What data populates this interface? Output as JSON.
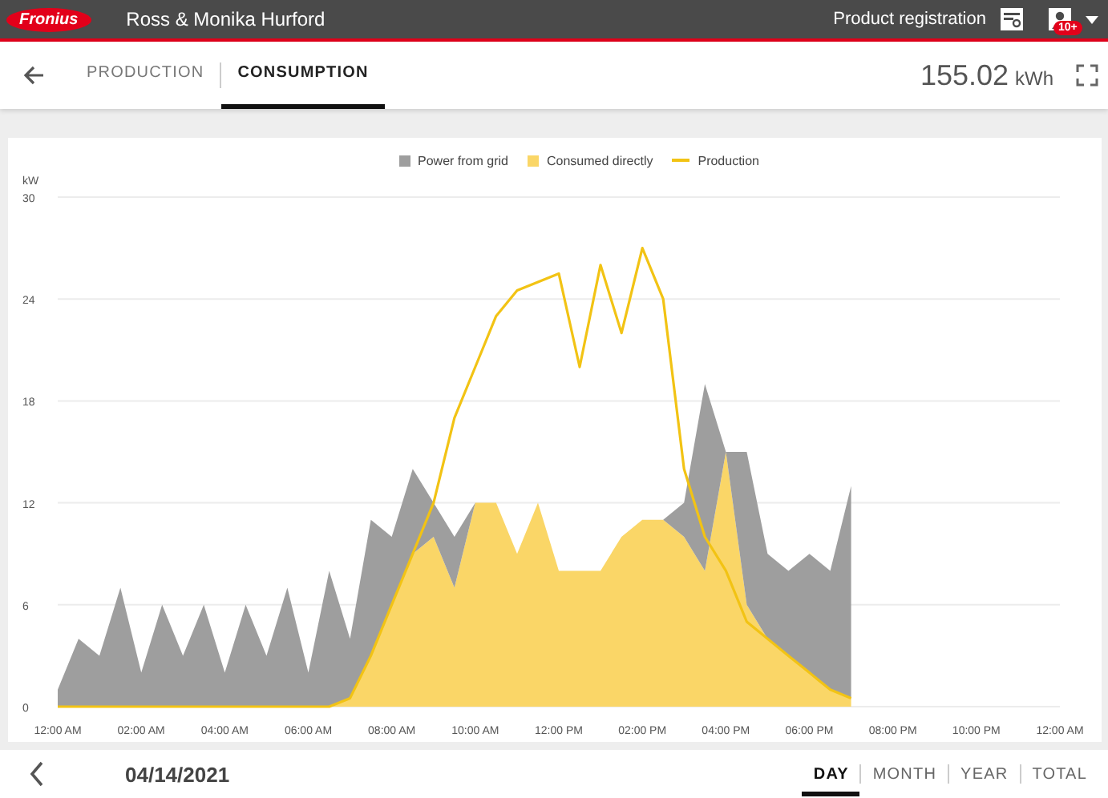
{
  "header": {
    "logo": "Fronius",
    "user_name": "Ross & Monika Hurford",
    "product_registration": "Product registration",
    "notification_badge": "10+"
  },
  "tabs": [
    {
      "label": "PRODUCTION",
      "selected": false
    },
    {
      "label": "CONSUMPTION",
      "selected": true
    }
  ],
  "total": {
    "value": "155.02",
    "unit": "kWh"
  },
  "chart": {
    "unit_label": "kW",
    "chart_data": {
      "type": "area",
      "stacked": true,
      "grid": true,
      "x": [
        0,
        0.5,
        1,
        1.5,
        2,
        2.5,
        3,
        3.5,
        4,
        4.5,
        5,
        5.5,
        6,
        6.5,
        7,
        7.5,
        8,
        8.5,
        9,
        9.5,
        10,
        10.5,
        11,
        11.5,
        12,
        12.5,
        13,
        13.5,
        14,
        14.5,
        15,
        15.5,
        16,
        16.5,
        17,
        17.5,
        18,
        18.5,
        19
      ],
      "xlim": [
        0,
        24
      ],
      "ylim": [
        0,
        30
      ],
      "yticks": [
        0,
        6,
        12,
        18,
        24,
        30
      ],
      "xticks": [
        {
          "value": 0,
          "label": "12:00 AM"
        },
        {
          "value": 2,
          "label": "02:00 AM"
        },
        {
          "value": 4,
          "label": "04:00 AM"
        },
        {
          "value": 6,
          "label": "06:00 AM"
        },
        {
          "value": 8,
          "label": "08:00 AM"
        },
        {
          "value": 10,
          "label": "10:00 AM"
        },
        {
          "value": 12,
          "label": "12:00 PM"
        },
        {
          "value": 14,
          "label": "02:00 PM"
        },
        {
          "value": 16,
          "label": "04:00 PM"
        },
        {
          "value": 18,
          "label": "06:00 PM"
        },
        {
          "value": 20,
          "label": "08:00 PM"
        },
        {
          "value": 22,
          "label": "10:00 PM"
        },
        {
          "value": 24,
          "label": "12:00 AM"
        }
      ],
      "series": [
        {
          "name": "Power from grid",
          "color": "#9e9e9e",
          "type": "area",
          "values": [
            1,
            4,
            3,
            7,
            2,
            6,
            3,
            6,
            2,
            6,
            3,
            7,
            2,
            8,
            3.5,
            8,
            4,
            5,
            2,
            3,
            0,
            0,
            0,
            0,
            0,
            0,
            0,
            0,
            0,
            0,
            2,
            11,
            0,
            9,
            5,
            5,
            7,
            7,
            12.5
          ]
        },
        {
          "name": "Consumed directly",
          "color": "#fad667",
          "type": "area",
          "values": [
            0,
            0,
            0,
            0,
            0,
            0,
            0,
            0,
            0,
            0,
            0,
            0,
            0,
            0,
            0.5,
            3,
            6,
            9,
            10,
            7,
            12,
            12,
            9,
            12,
            8,
            8,
            8,
            10,
            11,
            11,
            10,
            8,
            15,
            6,
            4,
            3,
            2,
            1,
            0.5
          ]
        },
        {
          "name": "Production",
          "color": "#f2c314",
          "type": "line",
          "values": [
            0,
            0,
            0,
            0,
            0,
            0,
            0,
            0,
            0,
            0,
            0,
            0,
            0,
            0,
            0.5,
            3,
            6,
            9,
            12,
            17,
            20,
            23,
            24.5,
            25,
            25.5,
            20,
            26,
            22,
            27,
            24,
            14,
            10,
            8,
            5,
            4,
            3,
            2,
            1,
            0.5
          ]
        }
      ]
    }
  },
  "footer": {
    "date": "04/14/2021",
    "periods": [
      {
        "label": "DAY",
        "selected": true
      },
      {
        "label": "MONTH",
        "selected": false
      },
      {
        "label": "YEAR",
        "selected": false
      },
      {
        "label": "TOTAL",
        "selected": false
      }
    ]
  }
}
